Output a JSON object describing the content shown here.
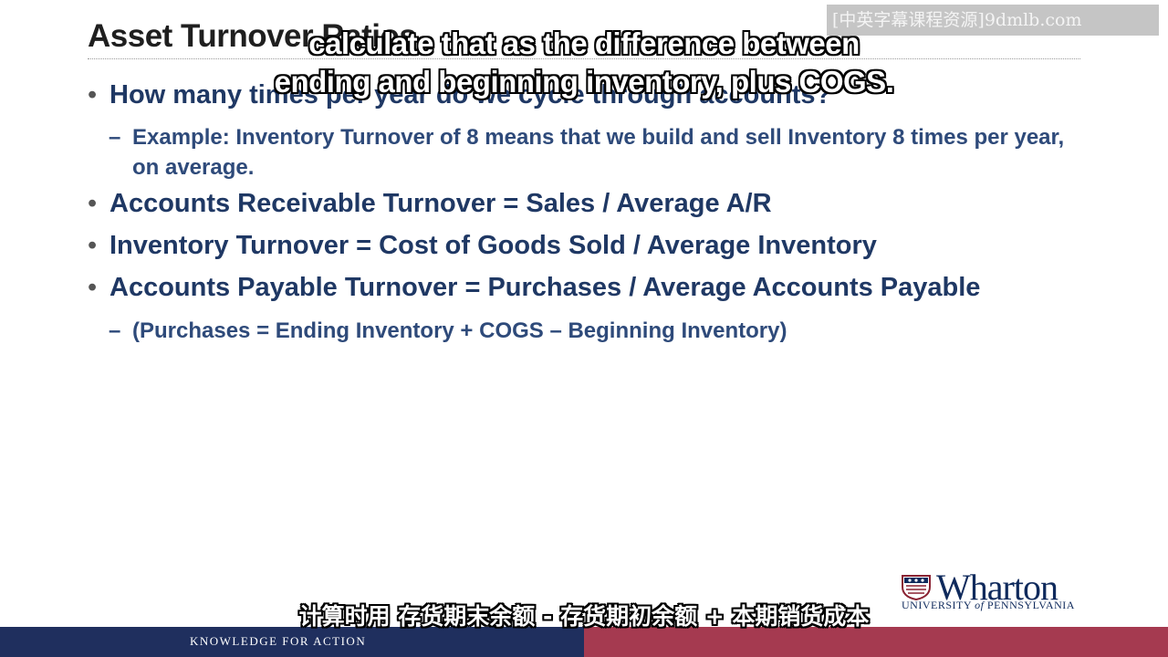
{
  "slide": {
    "title": "Asset Turnover Ratios",
    "bullets": [
      {
        "level": 1,
        "text": "How many times per year do we cycle through accounts?"
      },
      {
        "level": 2,
        "text": "Example: Inventory Turnover of 8 means that we build and sell Inventory 8 times per year, on average."
      },
      {
        "level": 1,
        "text": "Accounts Receivable Turnover = Sales / Average A/R"
      },
      {
        "level": 1,
        "text": "Inventory Turnover = Cost of Goods Sold / Average Inventory"
      },
      {
        "level": 1,
        "text": "Accounts Payable Turnover = Purchases / Average Accounts Payable"
      },
      {
        "level": 2,
        "text": "(Purchases = Ending Inventory + COGS – Beginning Inventory)"
      }
    ]
  },
  "subtitles": {
    "english_line1": "calculate that as the difference between",
    "english_line2": "ending and beginning inventory, plus COGS.",
    "chinese": "计算时用 存货期末余额 - 存货期初余额 + 本期销货成本"
  },
  "watermark": "[中英字幕课程资源]9dmlb.com",
  "logo": {
    "name": "Wharton",
    "university_prefix": "UNIVERSITY ",
    "university_of": "of",
    "university_suffix": " PENNSYLVANIA"
  },
  "footer": {
    "tagline": "KNOWLEDGE FOR ACTION"
  },
  "colors": {
    "title": "#1f1f1f",
    "bullet_text": "#1f3864",
    "footer_blue": "#1f2f5e",
    "footer_red": "#a53a50"
  }
}
